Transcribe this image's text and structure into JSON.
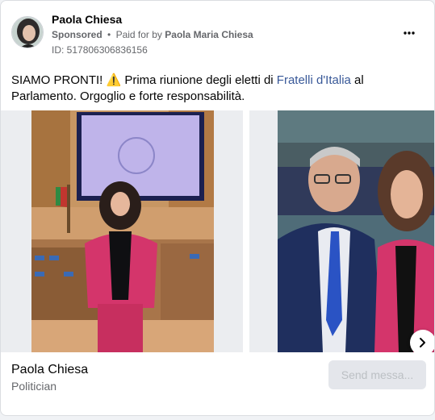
{
  "post": {
    "author_name": "Paola Chiesa",
    "sponsored_label": "Sponsored",
    "separator": "•",
    "paid_for_label": "Paid for by",
    "paid_for_name": "Paola Maria Chiesa",
    "ad_id": "ID: 517806306836156",
    "more_icon": "more-horizontal-icon",
    "text_before_link": "SIAMO PRONTI! ⚠️ Prima riunione degli eletti di ",
    "text_link": "Fratelli d'Italia",
    "text_after_link": " al Parlamento. Orgoglio e forte responsabilità."
  },
  "carousel": {
    "slides": [
      {
        "icon": "photo-woman-in-assembly-hall"
      },
      {
        "icon": "photo-woman-with-man"
      }
    ],
    "next_icon": "chevron-right-icon",
    "footer_name": "Paola Chiesa",
    "footer_role": "Politician",
    "cta_label": "Send messa..."
  },
  "colors": {
    "link": "#385898",
    "secondary_text": "#65676b",
    "jacket_pink": "#d4356b",
    "tie_blue": "#2a53c4"
  }
}
